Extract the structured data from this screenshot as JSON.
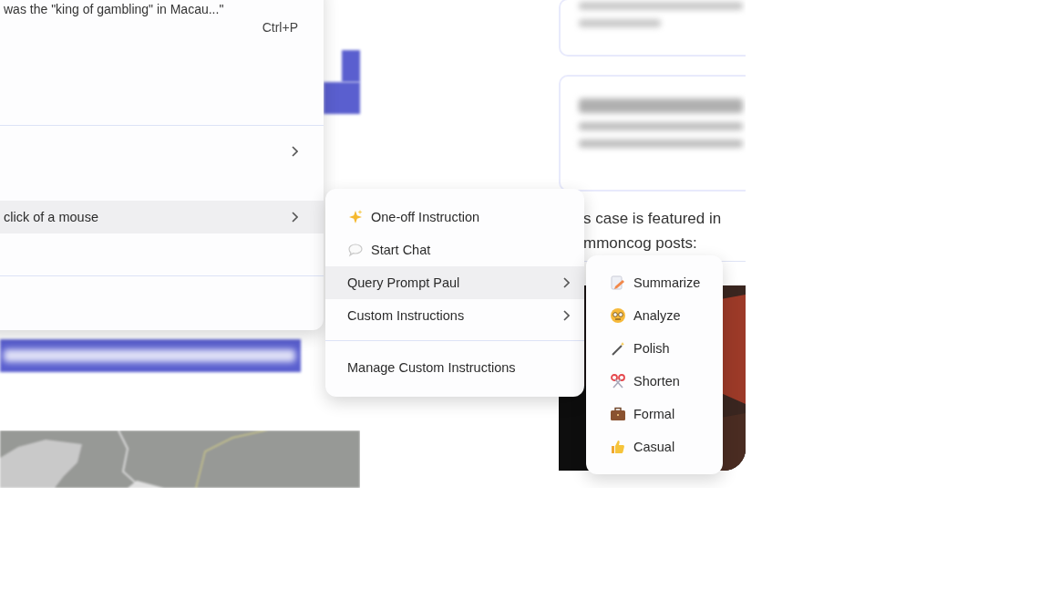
{
  "context_menu": {
    "sections": [
      {
        "items": [
          {
            "kind": "info",
            "text": "was the \"king of gambling\" in Macau...\"",
            "shortcut": "Ctrl+P"
          }
        ]
      },
      {
        "items": [
          {
            "kind": "submenu",
            "selected": false
          },
          {
            "kind": "submenu",
            "label": "click of a mouse",
            "selected": true
          }
        ]
      }
    ]
  },
  "ai_menu": {
    "sections": [
      {
        "items": [
          {
            "kind": "action",
            "label": "One-off Instruction",
            "selected": false
          },
          {
            "kind": "action",
            "label": "Start Chat",
            "selected": false
          },
          {
            "kind": "submenu",
            "label": "Query Prompt Paul",
            "selected": true
          },
          {
            "kind": "submenu",
            "label": "Custom Instructions",
            "selected": false
          }
        ]
      },
      {
        "items": [
          {
            "kind": "plain",
            "label": "Manage Custom Instructions",
            "selected": false
          }
        ]
      }
    ]
  },
  "prompt_menu": {
    "items": [
      {
        "label": "Summarize"
      },
      {
        "label": "Analyze"
      },
      {
        "label": "Polish"
      },
      {
        "label": "Shorten"
      },
      {
        "label": "Formal"
      },
      {
        "label": "Casual"
      }
    ]
  },
  "article": {
    "texts": [
      "s case is featured in",
      "mmoncog posts:"
    ]
  }
}
